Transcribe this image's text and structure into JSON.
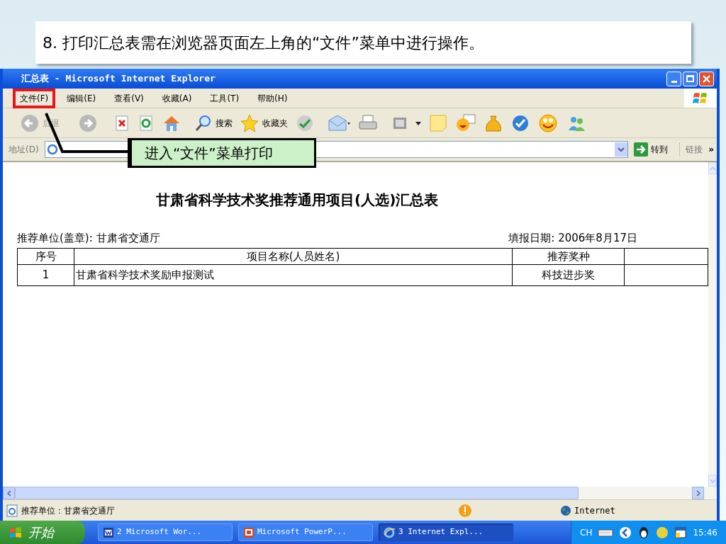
{
  "slide_heading": "8. 打印汇总表需在浏览器页面左上角的“文件”菜单中进行操作。",
  "window": {
    "title": "汇总表 - Microsoft Internet Explorer"
  },
  "menu": [
    {
      "label": "文件(F)",
      "annotated": true
    },
    {
      "label": "编辑(E)",
      "annotated": false
    },
    {
      "label": "查看(V)",
      "annotated": false
    },
    {
      "label": "收藏(A)",
      "annotated": false
    },
    {
      "label": "工具(T)",
      "annotated": false
    },
    {
      "label": "帮助(H)",
      "annotated": false
    }
  ],
  "callout": {
    "text": "进入“文件”菜单打印"
  },
  "toolbar": {
    "back": "后退",
    "search": "搜索",
    "favorites": "收藏夹"
  },
  "address_bar": {
    "label": "地址(D)",
    "go": "转到",
    "links": "链接",
    "more": "»"
  },
  "document": {
    "title": "甘肃省科学技术奖推荐通用项目(人选)汇总表",
    "unit": "推荐单位(盖章): 甘肃省交通厅",
    "date": "填报日期: 2006年8月17日",
    "table": {
      "columns": [
        "序号",
        "项目名称(人员姓名)",
        "推荐奖种"
      ],
      "rows": [
        [
          "1",
          "甘肃省科学技术奖励申报测试",
          "科技进步奖"
        ]
      ]
    }
  },
  "status_bar": {
    "text": "推荐单位：甘肃省交通厅",
    "zone": "Internet"
  },
  "taskbar": {
    "start": "开始",
    "tasks": [
      {
        "label": "2 Microsoft Wor...",
        "kind": "word",
        "selected": false
      },
      {
        "label": "Microsoft PowerP...",
        "kind": "powerpoint",
        "selected": false
      },
      {
        "label": "3 Internet Expl...",
        "kind": "ie",
        "selected": true
      }
    ],
    "language": "CH",
    "time": "15:46"
  }
}
